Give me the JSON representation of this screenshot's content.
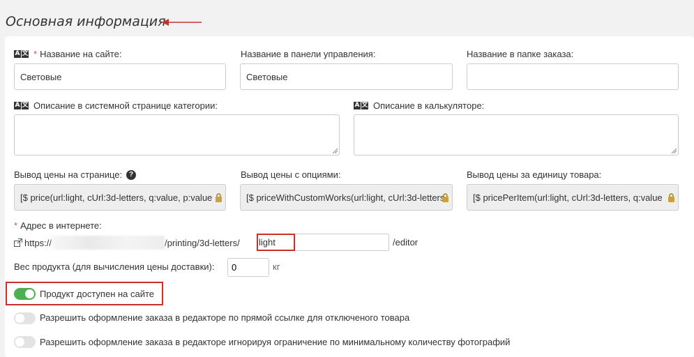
{
  "section": {
    "title": "Основная информация"
  },
  "fields": {
    "site_name": {
      "label": "Название на сайте:",
      "value": "Световые"
    },
    "admin_name": {
      "label": "Название в панели управления:",
      "value": "Световые"
    },
    "order_folder_name": {
      "label": "Название в папке заказа:",
      "value": ""
    },
    "category_description": {
      "label": "Описание в системной странице категории:",
      "value": ""
    },
    "calculator_description": {
      "label": "Описание в калькуляторе:",
      "value": ""
    },
    "price_output": {
      "label": "Вывод цены на странице:",
      "value": "[$ price(url:light, cUrl:3d-letters, q:value, p:value"
    },
    "price_options": {
      "label": "Вывод цены с опциями:",
      "value": "[$ priceWithCustomWorks(url:light, cUrl:3d-letters"
    },
    "price_per_item": {
      "label": "Вывод цены за единицу товара:",
      "value": "[$ pricePerItem(url:light, cUrl:3d-letters, q:value"
    }
  },
  "url": {
    "label": "Адрес в интернете:",
    "prefix": "https://",
    "path": "/printing/3d-letters/",
    "slug": "light",
    "suffix": "/editor"
  },
  "weight": {
    "label": "Вес продукта (для вычисления цены доставки):",
    "value": "0",
    "unit": "кг"
  },
  "toggles": [
    {
      "label": "Продукт доступен на сайте",
      "on": true
    },
    {
      "label": "Разрешить оформление заказа в редакторе по прямой ссылке для отключеного товара",
      "on": false
    },
    {
      "label": "Разрешить оформление заказа в редакторе игнорируя ограничение по минимальному количеству фотографий",
      "on": false
    }
  ],
  "icons": {
    "translate": "translate-icon",
    "help": "help-icon",
    "lock": "lock-icon",
    "link": "external-link-icon"
  },
  "colors": {
    "highlight": "#c9302c",
    "toggle_on": "#4caf50",
    "required": "#d9534f"
  }
}
